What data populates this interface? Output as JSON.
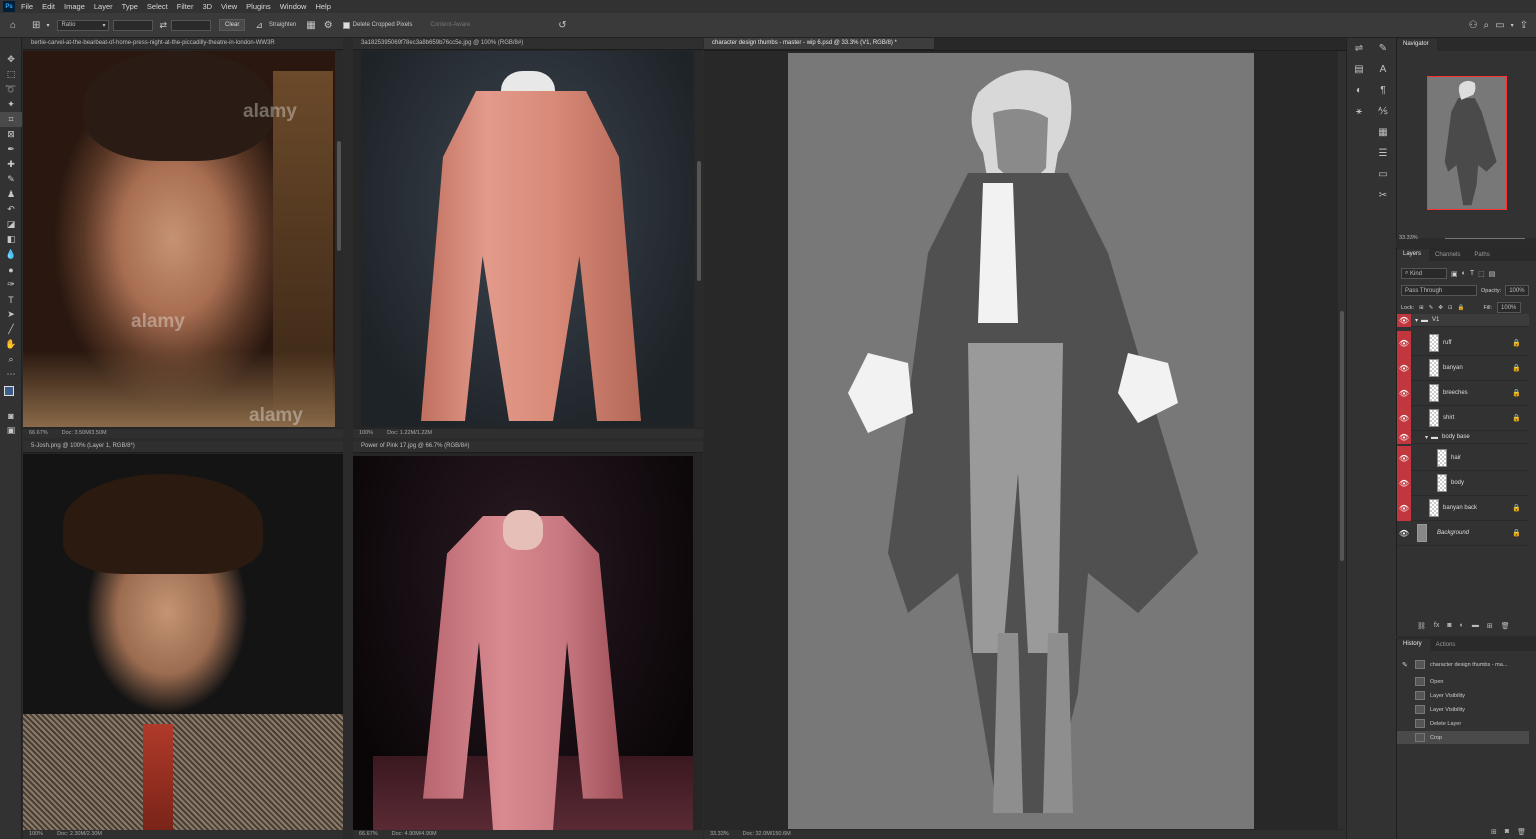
{
  "app": {
    "logo": "Ps"
  },
  "menu": [
    "File",
    "Edit",
    "Image",
    "Layer",
    "Type",
    "Select",
    "Filter",
    "3D",
    "View",
    "Plugins",
    "Window",
    "Help"
  ],
  "options": {
    "ratio": "Ratio",
    "clear": "Clear",
    "straighten": "Straighten",
    "delete_cropped": "Delete Cropped Pixels",
    "content_aware": "Content-Aware"
  },
  "docs": [
    {
      "tab": "bertie-carvel-at-the-bearbeat-of-home-press-night-at-the-piccadilly-theatre-in-london-WW3R",
      "zoom": "66.67%",
      "docinfo": "Doc: 3.50M/3.50M",
      "watermarks": [
        "alamy",
        "alamy",
        "alamy"
      ]
    },
    {
      "tab": "3a1825395069f78ec3a8b659b76cc5e.jpg @ 100% (RGB/8#)",
      "zoom": "100%",
      "docinfo": "Doc: 1.22M/1.22M"
    },
    {
      "tab": "5-Josh.png @ 100% (Layer 1, RGB/8*)",
      "zoom": "100%",
      "docinfo": "Doc: 2.30M/2.30M"
    },
    {
      "tab": "Power of Pink 17.jpg @ 66.7% (RGB/8#)",
      "zoom": "66.67%",
      "docinfo": "Doc: 4.90M/4.90M"
    },
    {
      "tab": "character design thumbs - master - wip 6.psd @ 33.3% (V1, RGB/8) *",
      "zoom": "33.33%",
      "docinfo": "Doc: 32.0M/150.6M"
    }
  ],
  "navigator": {
    "title": "Navigator",
    "zoom": "33.33%"
  },
  "layers_panel": {
    "tabs": [
      "Layers",
      "Channels",
      "Paths"
    ],
    "kind": "Kind",
    "blend": "Pass Through",
    "opacity_label": "Opacity:",
    "opacity": "100%",
    "lock_label": "Lock:",
    "fill_label": "Fill:",
    "fill": "100%",
    "layers": [
      {
        "name": "V1",
        "type": "group",
        "visible": true
      },
      {
        "name": "ruff",
        "visible": true
      },
      {
        "name": "banyan",
        "visible": true
      },
      {
        "name": "breeches",
        "visible": true
      },
      {
        "name": "shirt",
        "visible": true
      },
      {
        "name": "body base",
        "type": "group",
        "visible": true
      },
      {
        "name": "hair",
        "visible": true
      },
      {
        "name": "body",
        "visible": true
      },
      {
        "name": "banyan back",
        "visible": true
      },
      {
        "name": "Background",
        "visible": true
      }
    ]
  },
  "history_panel": {
    "tabs": [
      "History",
      "Actions"
    ],
    "snapshot": "character design thumbs - ma...",
    "steps": [
      "Open",
      "Layer Visibility",
      "Layer Visibility",
      "Delete Layer",
      "Crop"
    ]
  },
  "colors": {
    "accent_eye": "#c2363d",
    "canvas_gray": "#777777",
    "nav_frame": "#ff3333"
  }
}
